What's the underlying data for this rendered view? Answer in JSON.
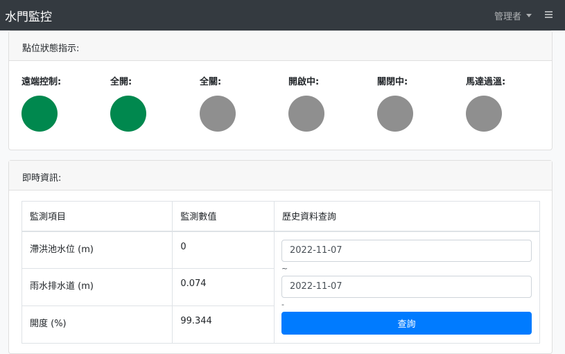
{
  "app": {
    "title": "水門監控"
  },
  "header": {
    "user_label": "管理者"
  },
  "status_card": {
    "title": "點位狀態指示:",
    "indicators": [
      {
        "label": "遠端控制:",
        "state": "on",
        "color": "#00884e"
      },
      {
        "label": "全開:",
        "state": "on",
        "color": "#00884e"
      },
      {
        "label": "全關:",
        "state": "off",
        "color": "#8f8f8f"
      },
      {
        "label": "開啟中:",
        "state": "off",
        "color": "#8f8f8f"
      },
      {
        "label": "關閉中:",
        "state": "off",
        "color": "#8f8f8f"
      },
      {
        "label": "馬達過溫:",
        "state": "off",
        "color": "#8f8f8f"
      }
    ]
  },
  "realtime_card": {
    "title": "即時資訊:",
    "columns": [
      "監測項目",
      "監測數值",
      "歷史資料查詢"
    ],
    "rows": [
      {
        "item": "滯洪池水位 (m)",
        "value": "0"
      },
      {
        "item": "雨水排水道 (m)",
        "value": "0.074"
      },
      {
        "item": "開度 (%)",
        "value": "99.344"
      }
    ],
    "query": {
      "start_date": "2022-11-07",
      "range_separator": "~",
      "end_date": "2022-11-07",
      "button_separator": "-",
      "button_label": "查詢"
    }
  },
  "colors": {
    "topbar": "#343a40",
    "primary": "#007bff",
    "on": "#00884e",
    "off": "#8f8f8f"
  }
}
